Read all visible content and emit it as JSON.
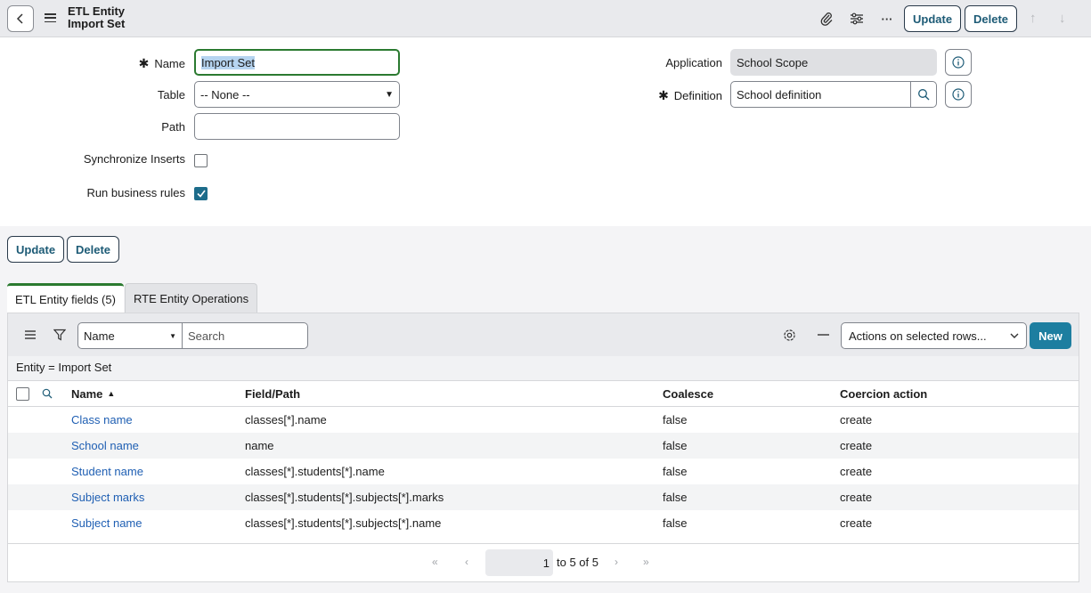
{
  "header": {
    "title_line1": "ETL Entity",
    "title_line2": "Import Set",
    "update_label": "Update",
    "delete_label": "Delete",
    "more_label": "···"
  },
  "form": {
    "name_label": "Name",
    "name_value": "Import Set",
    "table_label": "Table",
    "table_value": "-- None --",
    "path_label": "Path",
    "path_value": "",
    "sync_label": "Synchronize Inserts",
    "sync_checked": false,
    "run_rules_label": "Run business rules",
    "run_rules_checked": true,
    "application_label": "Application",
    "application_value": "School Scope",
    "definition_label": "Definition",
    "definition_value": "School definition",
    "required_mark": "✱"
  },
  "bottom_buttons": {
    "update_label": "Update",
    "delete_label": "Delete"
  },
  "tabs": [
    {
      "label": "ETL Entity fields (5)",
      "active": true
    },
    {
      "label": "RTE Entity Operations",
      "active": false
    }
  ],
  "list": {
    "filter_field": "Name",
    "search_placeholder": "Search",
    "actions_label": "Actions on selected rows...",
    "new_label": "New",
    "breadcrumb": "Entity = Import Set",
    "columns": [
      "Name",
      "Field/Path",
      "Coalesce",
      "Coercion action"
    ],
    "sort_indicator": "▲",
    "rows": [
      {
        "name": "Class name",
        "path": "classes[*].name",
        "coalesce": "false",
        "coercion": "create"
      },
      {
        "name": "School name",
        "path": "name",
        "coalesce": "false",
        "coercion": "create"
      },
      {
        "name": "Student name",
        "path": "classes[*].students[*].name",
        "coalesce": "false",
        "coercion": "create"
      },
      {
        "name": "Subject marks",
        "path": "classes[*].students[*].subjects[*].marks",
        "coalesce": "false",
        "coercion": "create"
      },
      {
        "name": "Subject name",
        "path": "classes[*].students[*].subjects[*].name",
        "coalesce": "false",
        "coercion": "create"
      }
    ],
    "pager": {
      "current_page": "1",
      "range_text": "to 5 of 5"
    }
  }
}
